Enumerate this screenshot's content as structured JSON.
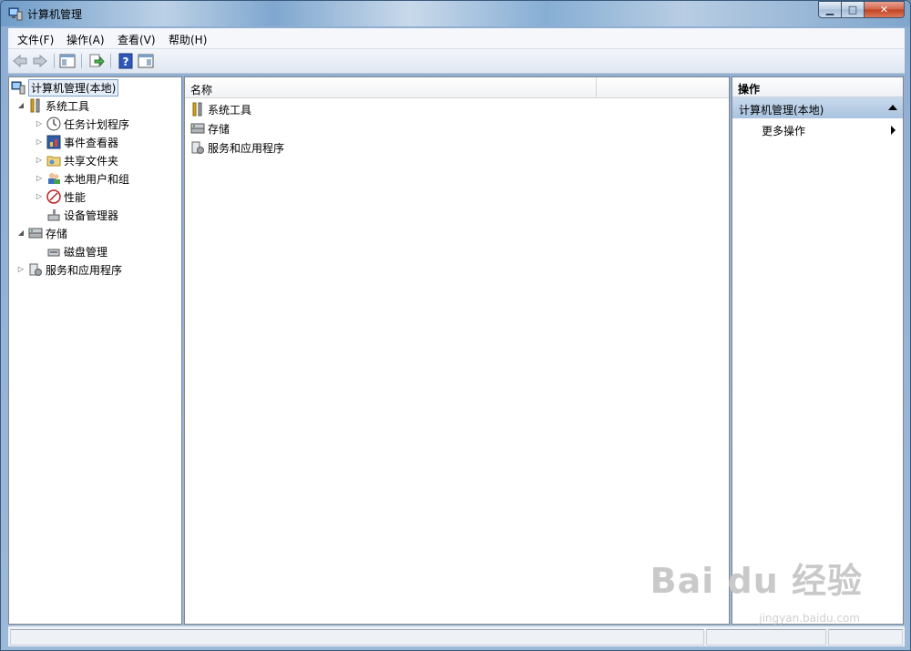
{
  "window": {
    "title": "计算机管理"
  },
  "menu": [
    "文件(F)",
    "操作(A)",
    "查看(V)",
    "帮助(H)"
  ],
  "tree": {
    "root": "计算机管理(本地)",
    "items": [
      {
        "label": "系统工具",
        "level": 1,
        "expander": "open",
        "icon": "tools-icon"
      },
      {
        "label": "任务计划程序",
        "level": 2,
        "expander": "closed",
        "icon": "clock-icon"
      },
      {
        "label": "事件查看器",
        "level": 2,
        "expander": "closed",
        "icon": "event-viewer-icon"
      },
      {
        "label": "共享文件夹",
        "level": 2,
        "expander": "closed",
        "icon": "shared-folder-icon"
      },
      {
        "label": "本地用户和组",
        "level": 2,
        "expander": "closed",
        "icon": "users-icon"
      },
      {
        "label": "性能",
        "level": 2,
        "expander": "closed",
        "icon": "performance-icon"
      },
      {
        "label": "设备管理器",
        "level": 2,
        "expander": "none",
        "icon": "device-manager-icon"
      },
      {
        "label": "存储",
        "level": 1,
        "expander": "open",
        "icon": "storage-icon"
      },
      {
        "label": "磁盘管理",
        "level": 2,
        "expander": "none",
        "icon": "disk-icon"
      },
      {
        "label": "服务和应用程序",
        "level": 1,
        "expander": "closed",
        "icon": "services-icon"
      }
    ]
  },
  "list": {
    "column_name": "名称",
    "items": [
      {
        "label": "系统工具",
        "icon": "tools-icon"
      },
      {
        "label": "存储",
        "icon": "storage-icon"
      },
      {
        "label": "服务和应用程序",
        "icon": "services-icon"
      }
    ]
  },
  "actions": {
    "header": "操作",
    "section": "计算机管理(本地)",
    "more": "更多操作"
  },
  "watermark": {
    "main": "Bai du 经验",
    "sub": "jingyan.baidu.com"
  },
  "colors": {
    "selection_border": "#7da2ce",
    "selection_bg": "#e5eef8",
    "actions_section": "#b9cfe6"
  }
}
